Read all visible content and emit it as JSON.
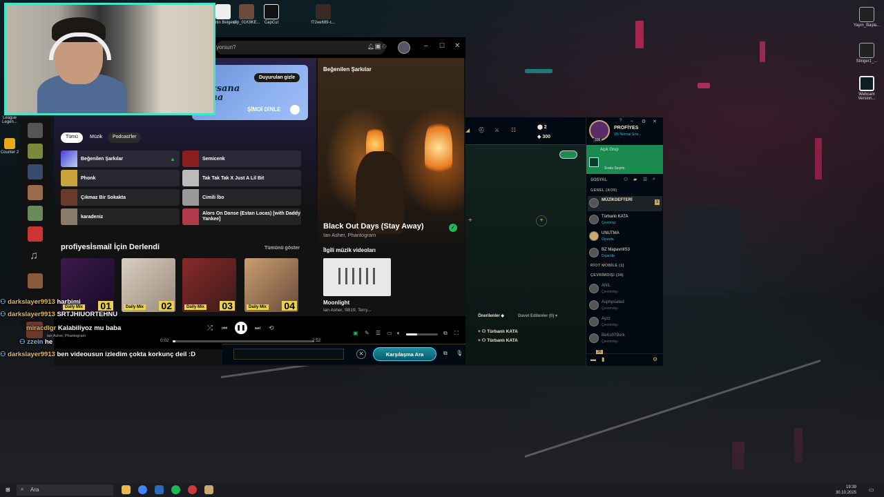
{
  "desktop": {
    "icons_top": [
      "Metin\nBelgesi",
      "clip_01K9KE...",
      "CapCut",
      "f72ee689-c..."
    ],
    "icons_right": [
      "Yayın_Başla...",
      "Stinger1_...",
      "Webcam\nVersion..."
    ],
    "icons_left": [
      "League\nLegen...",
      "Counter\n2"
    ]
  },
  "spotify": {
    "search_placeholder": "yorsun?",
    "banner_button": "Duyurulan gizle",
    "banner_cta": "ŞİMDİ DİNLE",
    "banner_title": "Kaçsana Bana",
    "chips": [
      "Tümü",
      "Müzik",
      "Podcast'ler"
    ],
    "tiles": [
      "Beğenilen Şarkılar",
      "Semicenk",
      "Phonk",
      "Tak Tak Tak X Just A Lil Bit",
      "Çıkmaz Bir Sokakta",
      "Cimili İbo",
      "karadeniz",
      "Alors On Danse (Estan Locas) [with Daddy Yankee]"
    ],
    "section_title": "profiyesİsmail İçin Derlendi",
    "show_all": "Tümünü göster",
    "mixes": [
      {
        "label": "Daily Mix",
        "num": "01"
      },
      {
        "label": "Daily Mix",
        "num": "02"
      },
      {
        "label": "Daily Mix",
        "num": "03"
      },
      {
        "label": "Daily Mix",
        "num": "04"
      }
    ],
    "right_panel": {
      "header": "Beğenilen Şarkılar",
      "track": "Black Out Days (Stay Away)",
      "artists": "Ian Asher, Phantogram",
      "videos_title": "İlgili müzik videoları",
      "video_title": "Moonlight",
      "video_artists": "Ian Asher, SB19, Terry..."
    },
    "player": {
      "now_title": "Kalabiliyoz mu baba",
      "now_artist": "Ian Asher, Phantogram",
      "time_elapsed": "0:02",
      "time_total": "2:52",
      "progress": 0.02
    }
  },
  "lol": {
    "currency1": "2",
    "currency2": "300",
    "profile_name": "PROFİYES",
    "profile_status": "1/5 Normal Sıra...",
    "level": "336",
    "party_label": "Açık Grup",
    "party_sub": "Sırala Seçimi",
    "social_label": "SOSYAL",
    "general_group": "GENEL (4/39)",
    "mobile_group": "RİOT MOBİLE (1)",
    "offline_group": "ÇEVRİMDIŞI (34)",
    "friends_online": [
      {
        "name": "MÜZİKDEFTERİ",
        "status": ""
      },
      {
        "name": "Türbanlı KATA",
        "status": "Çevrimiçi"
      },
      {
        "name": "UNUTMA",
        "status": "Oyunda"
      },
      {
        "name": "BZ MapavrilIS3",
        "status": "Dışarıda"
      }
    ],
    "friends_offline": [
      {
        "name": "ANIL",
        "status": "Çevrimdışı"
      },
      {
        "name": "Asphyxiated",
        "status": "Çevrimdışı"
      },
      {
        "name": "Ayzz",
        "status": "Çevrimdışı"
      },
      {
        "name": "BeKo07Berk",
        "status": "Çevrimdışı"
      }
    ],
    "tabs": [
      "Önerilenler",
      "Davet Edilenler (0)"
    ],
    "invites": [
      "Türbanlı KATA",
      "Türbanlı KATA"
    ],
    "badge": "3",
    "bottom_badge": "26",
    "find_match": "Karşılaşma Ara"
  },
  "chat": [
    {
      "user": "darkslayer9913",
      "msg": "harbimi"
    },
    {
      "user": "darkslayer9913",
      "msg": "SRTJHIUORTEHNU"
    },
    {
      "user": "miracdlgr",
      "msg": "Kalabiliyoz mu baba"
    },
    {
      "user": "zzein",
      "msg": "he"
    },
    {
      "user": "darkslayer9913",
      "msg": "ben videousun izledim çokta korkunç deil :D"
    }
  ],
  "taskbar": {
    "search_label": "Ara",
    "time": "19:39",
    "date": "30.10.2025"
  }
}
